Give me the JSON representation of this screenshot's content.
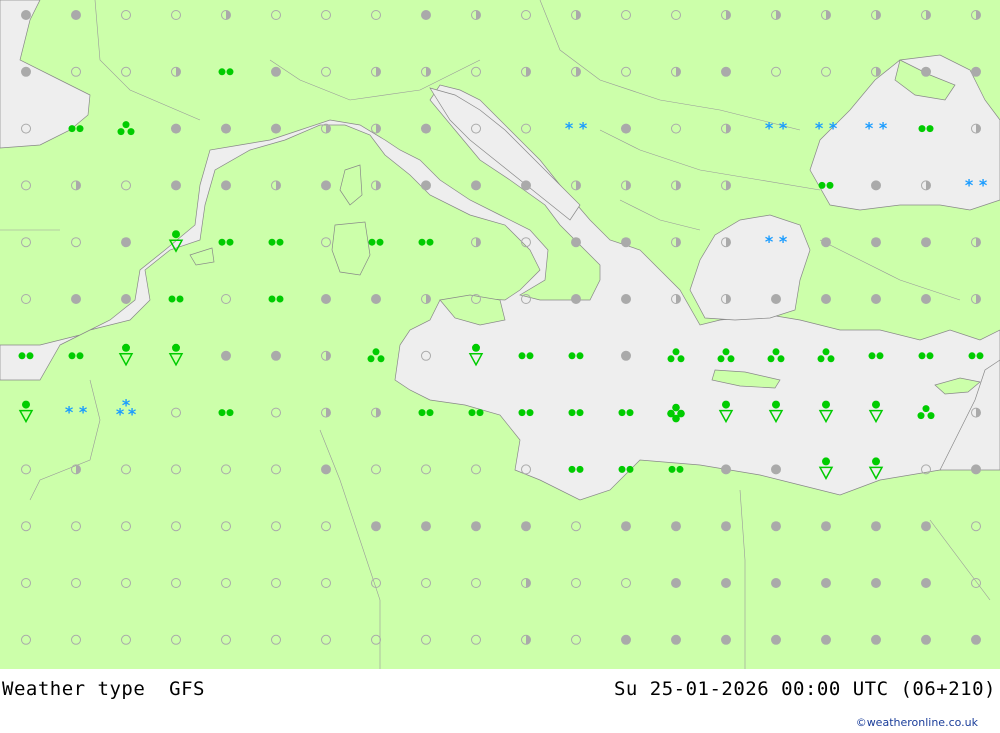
{
  "footer": {
    "title": "Weather type",
    "model": "GFS",
    "datetime": "Su 25-01-2026 00:00 UTC (06+210)",
    "credit": "©weatheronline.co.uk"
  },
  "colors": {
    "land": "#ccffaa",
    "sea": "#eeeeee",
    "border": "#999999",
    "dot_filled": "#aaaaaa",
    "rain": "#00cc00",
    "snow": "#1a9cff"
  },
  "legend_symbols": {
    "o": "clear-icon",
    "h": "partly-cloudy-icon",
    "c": "overcast-icon",
    "s": "shower-icon",
    "d": "drizzle-icon",
    "r": "rain-icon",
    "R": "heavy-rain-icon",
    "n": "snow-icon",
    "N": "snow-shower-icon",
    "m": "mixed-snow-icon",
    "u": "unknown"
  },
  "grid_rows": [
    "ccoohooochohoohhhhhh",
    "coohscohhohhohcoohcc",
    "osdccchhcooncohnnnsh",
    "ohocchchccchhhhuschn",
    "oocrssosshocchhnccch",
    "occsoscchoocchhcccch",
    "ssrrcchdorsscddddsss",
    "rnmosohhsssssRrrrrdh",
    "ohoooocoooosssccrroc",
    "oooooooccccoccccccco",
    "oooooooooohoocccccco",
    "oooooooooohocccccccc"
  ]
}
